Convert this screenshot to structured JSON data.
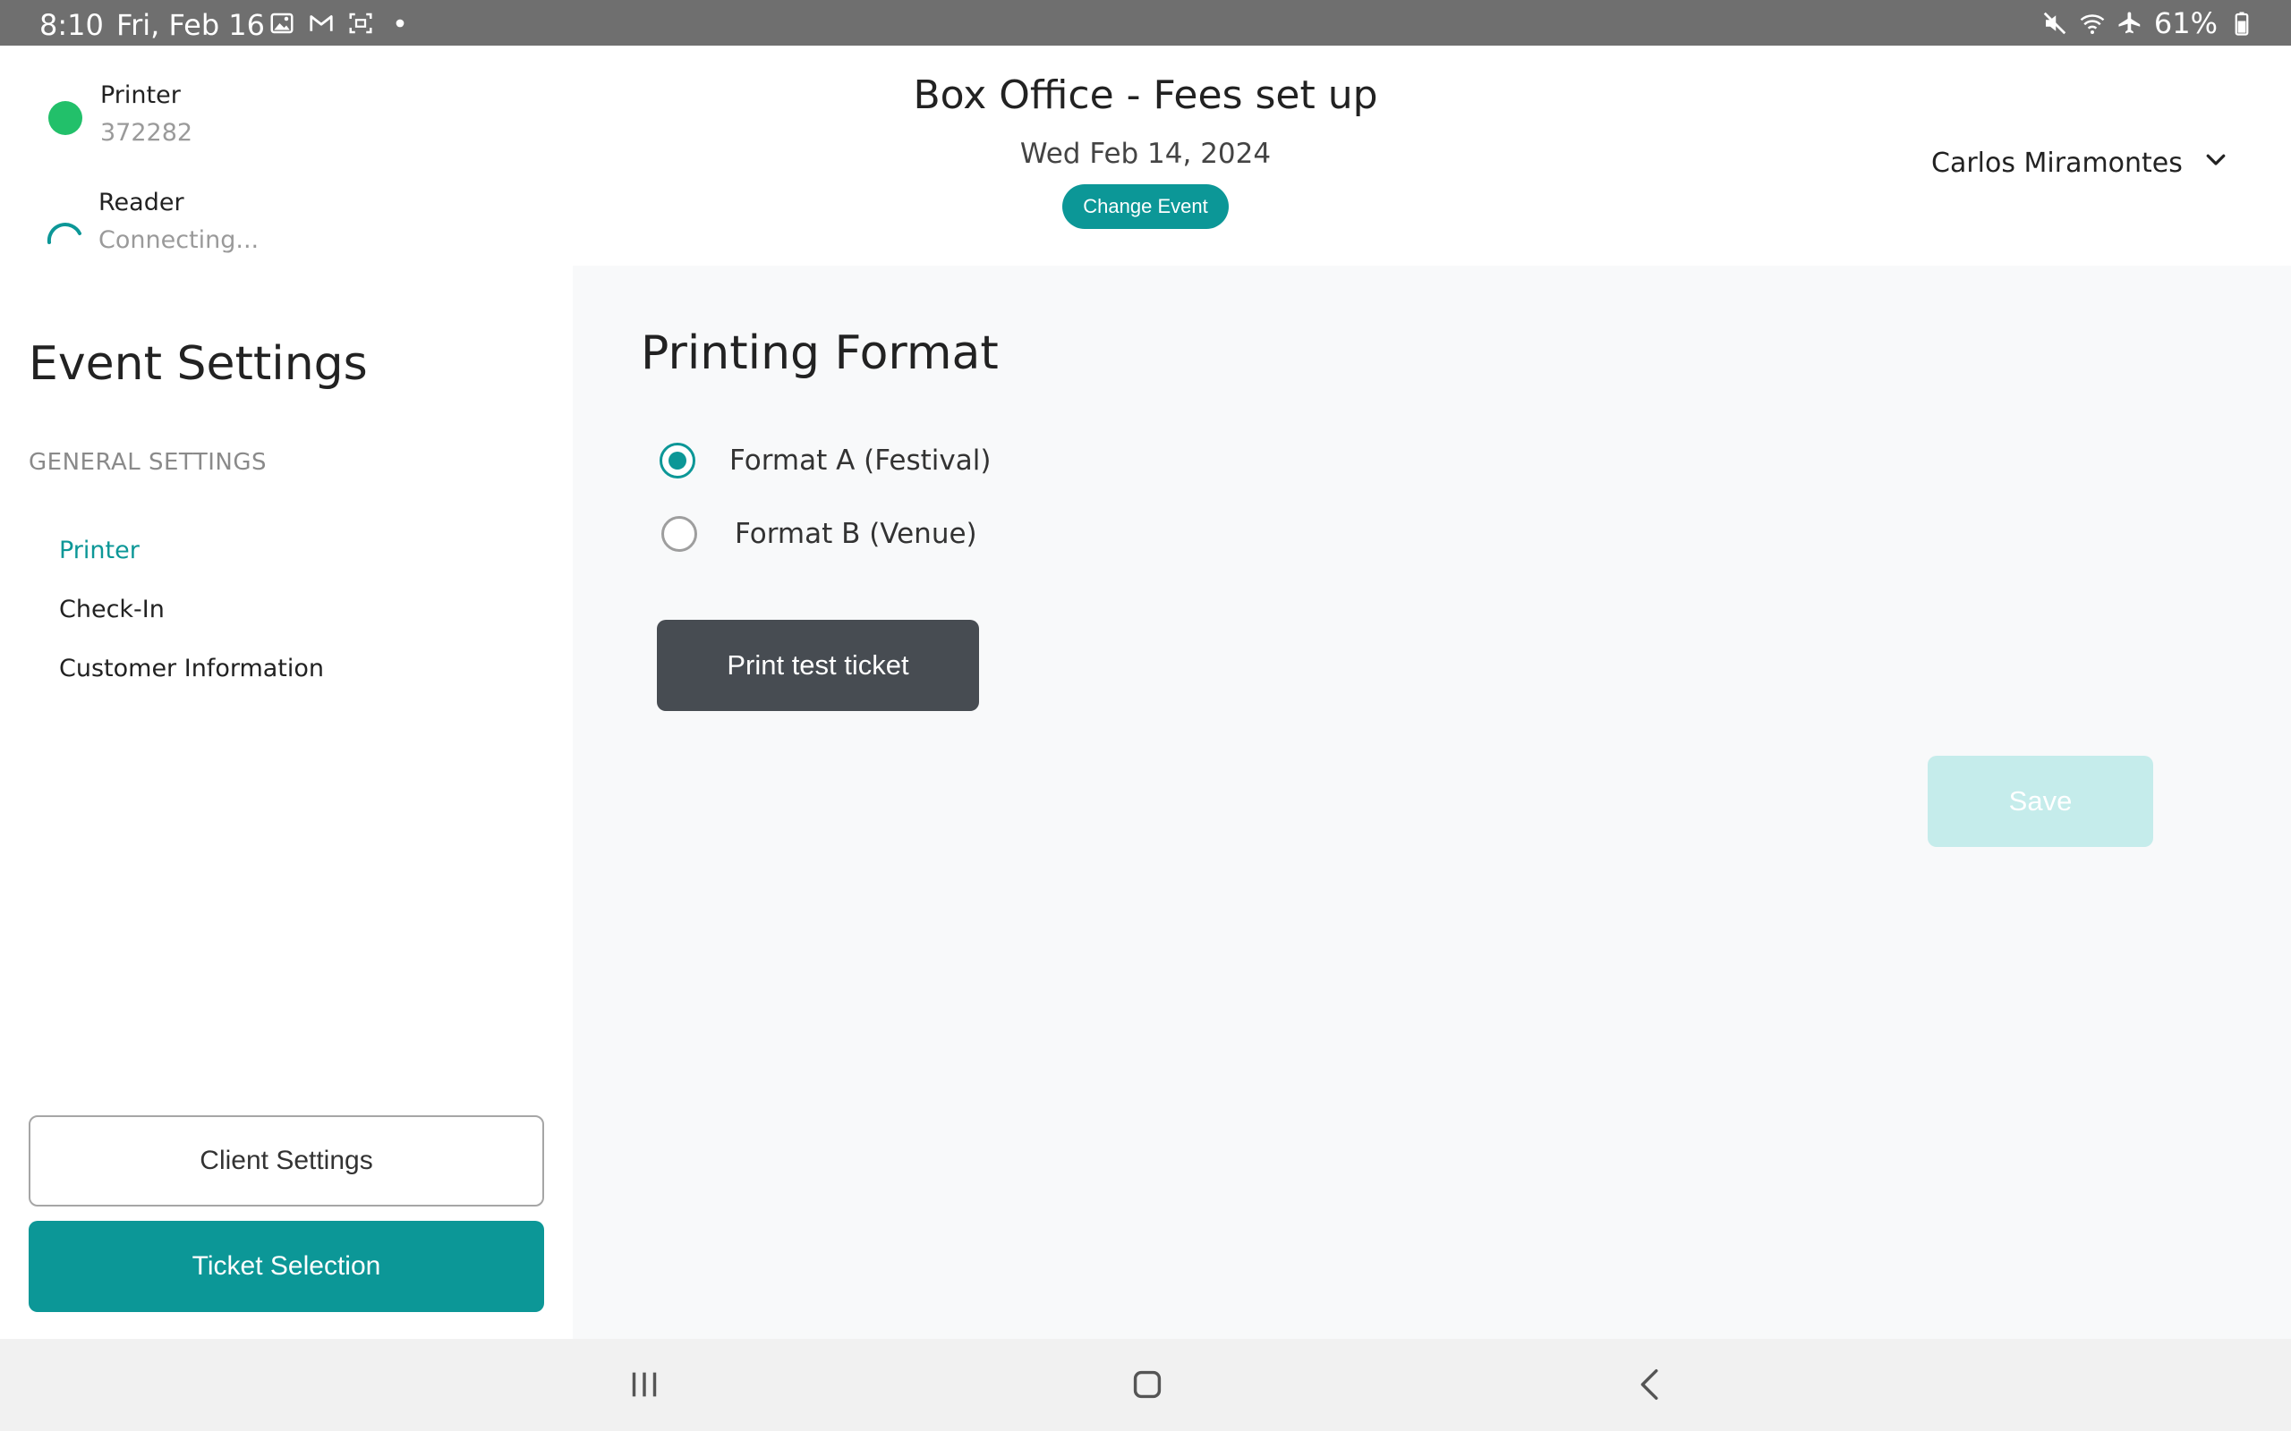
{
  "status_bar": {
    "time": "8:10",
    "date": "Fri, Feb 16",
    "battery": "61%",
    "left_icons": [
      "gallery-icon",
      "gmail-icon",
      "screenshot-icon",
      "dot-icon"
    ],
    "right_icons": [
      "mute-icon",
      "wifi-icon",
      "airplane-icon",
      "battery-icon"
    ]
  },
  "header": {
    "title": "Box Office - Fees set up",
    "date": "Wed Feb 14, 2024",
    "change_event_label": "Change Event",
    "user_name": "Carlos Miramontes",
    "devices": [
      {
        "name": "Printer",
        "status": "372282",
        "indicator_color": "#22c06a"
      },
      {
        "name": "Reader",
        "status": "Connecting...",
        "indicator_color": "#0c9797"
      }
    ]
  },
  "sidebar": {
    "title": "Event Settings",
    "section_label": "GENERAL SETTINGS",
    "items": [
      {
        "label": "Printer",
        "active": true
      },
      {
        "label": "Check-In",
        "active": false
      },
      {
        "label": "Customer Information",
        "active": false
      }
    ],
    "client_settings_label": "Client Settings",
    "ticket_selection_label": "Ticket Selection"
  },
  "main": {
    "title": "Printing Format",
    "options": [
      {
        "label": "Format A (Festival)",
        "selected": true
      },
      {
        "label": "Format B (Venue)",
        "selected": false
      }
    ],
    "print_test_label": "Print test ticket",
    "save_label": "Save"
  },
  "colors": {
    "accent": "#0c9797",
    "dark_button": "#474c52",
    "save_disabled": "#c5eceb"
  }
}
